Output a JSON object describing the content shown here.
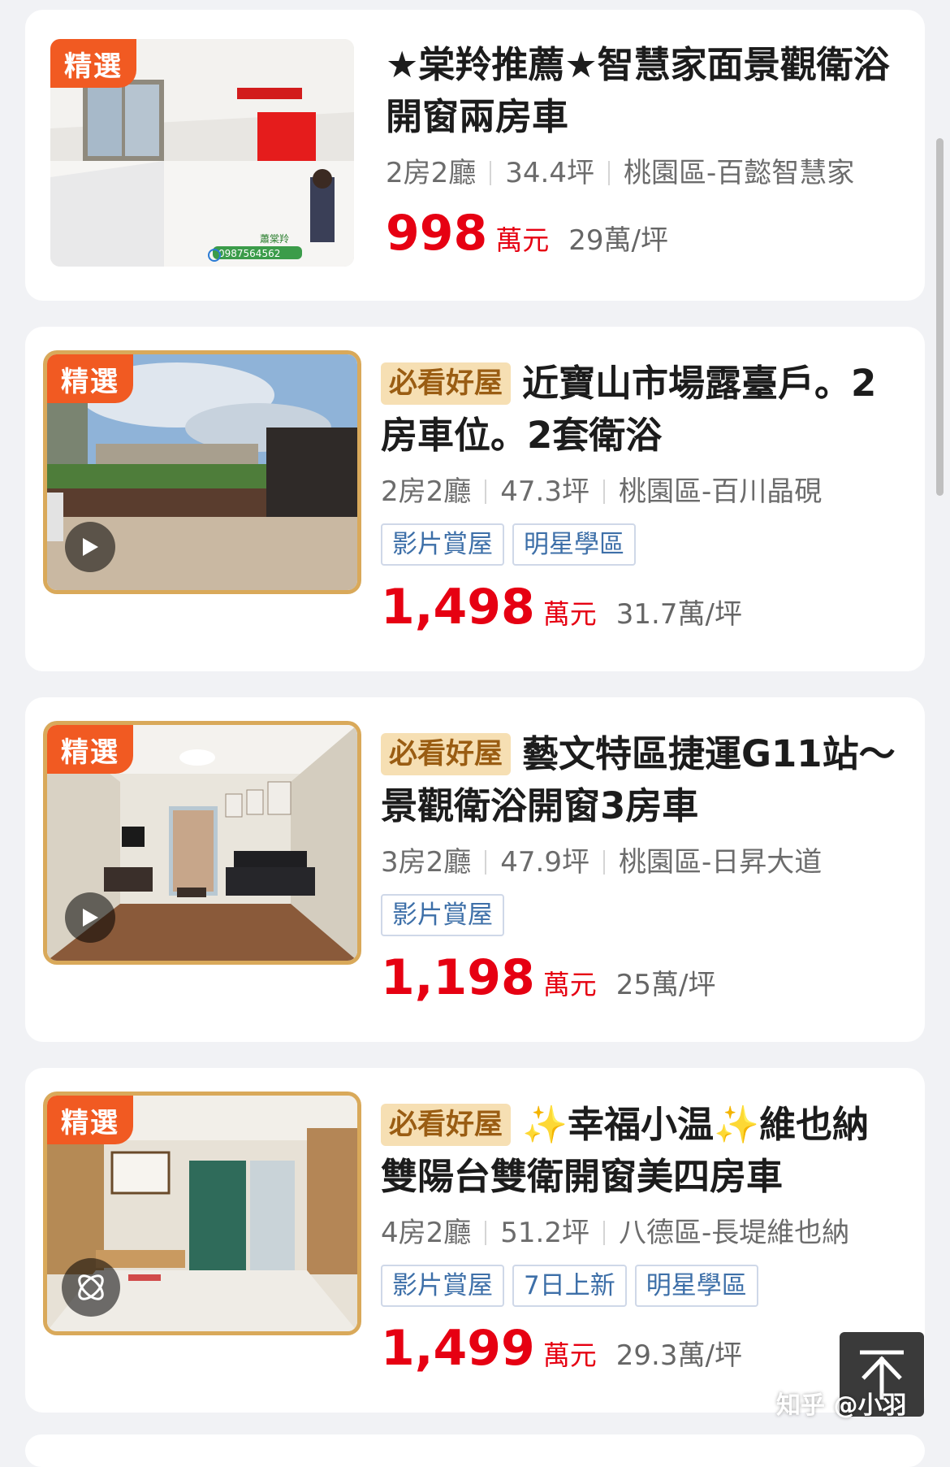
{
  "listings": [
    {
      "featured_label": "精選",
      "hot_label": "",
      "title": "★棠羚推薦★智慧家面景觀衛浴開窗兩房車",
      "layout": "2房2廳",
      "area": "34.4坪",
      "location": "桃園區-百懿智慧家",
      "tags": [],
      "price": "998",
      "price_unit": "萬元",
      "price_per_ping": "29萬/坪",
      "photo_overlay_name": "蕭棠羚",
      "photo_overlay_phone": "0987564562"
    },
    {
      "featured_label": "精選",
      "hot_label": "必看好屋",
      "title": "近寶山市場露臺戶。2房車位。2套衛浴",
      "layout": "2房2廳",
      "area": "47.3坪",
      "location": "桃園區-百川晶硯",
      "tags": [
        "影片賞屋",
        "明星學區"
      ],
      "price": "1,498",
      "price_unit": "萬元",
      "price_per_ping": "31.7萬/坪"
    },
    {
      "featured_label": "精選",
      "hot_label": "必看好屋",
      "title": "藝文特區捷運G11站～景觀衛浴開窗3房車",
      "layout": "3房2廳",
      "area": "47.9坪",
      "location": "桃園區-日昇大道",
      "tags": [
        "影片賞屋"
      ],
      "price": "1,198",
      "price_unit": "萬元",
      "price_per_ping": "25萬/坪"
    },
    {
      "featured_label": "精選",
      "hot_label": "必看好屋",
      "title": "✨幸福小温✨維也納雙陽台雙衛開窗美四房車",
      "layout": "4房2廳",
      "area": "51.2坪",
      "location": "八德區-長堤維也納",
      "tags": [
        "影片賞屋",
        "7日上新",
        "明星學區"
      ],
      "price": "1,499",
      "price_unit": "萬元",
      "price_per_ping": "29.3萬/坪"
    }
  ],
  "watermark": "知乎 @小羽",
  "icons": {
    "play": "play-icon",
    "vr": "vr-icon",
    "back_to_top": "back-to-top-icon"
  },
  "colors": {
    "price_red": "#e60012",
    "featured_orange": "#f15a22",
    "hot_tag_bg": "#f6dfb3",
    "chip_blue": "#3d6fa8",
    "gold_frame": "#d9a95a"
  }
}
